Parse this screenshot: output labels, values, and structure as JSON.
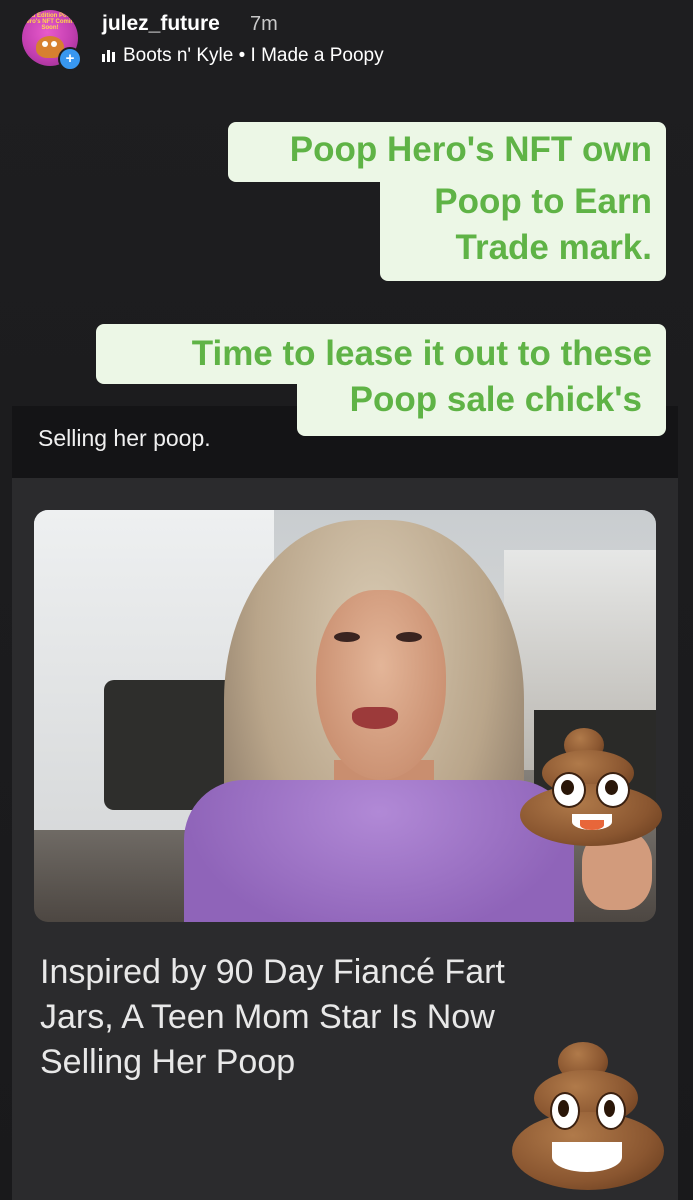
{
  "story": {
    "username": "julez_future",
    "time": "7m",
    "music": "Boots n' Kyle • I Made a Poopy",
    "avatar_text": "3rd Edition Poop Hero's NFT Coming Soon!",
    "add_badge": "+"
  },
  "captions": {
    "cap1_line1": "Poop Hero's NFT own",
    "cap1_line2": "Poop to Earn",
    "cap1_line3": "Trade mark.",
    "cap2_line1": "Time to lease it out to these",
    "cap2_line2": "Poop sale chick's"
  },
  "post": {
    "caption": "Selling her poop.",
    "headline_l1": "Inspired by 90 Day Fiancé Fart",
    "headline_l2": "Jars, A Teen Mom Star Is Now",
    "headline_l3": "Selling Her Poop"
  },
  "colors": {
    "caption_bg": "#ecf7e6",
    "caption_text": "#5fb346",
    "background": "#1c1c1e",
    "card": "#2b2b2d"
  },
  "icons": [
    "music-bars-icon",
    "add-story-icon",
    "poop-emoji-icon"
  ]
}
